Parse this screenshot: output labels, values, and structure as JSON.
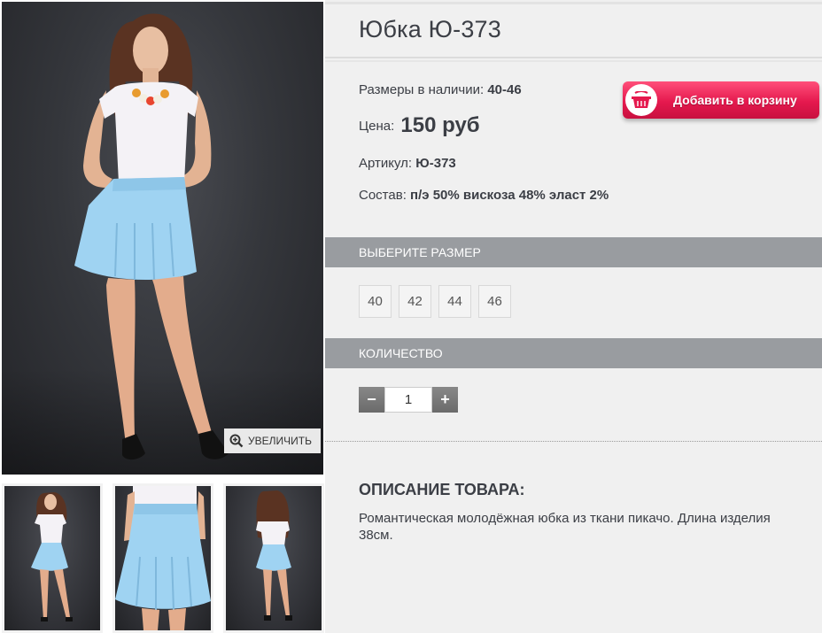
{
  "product": {
    "title": "Юбка Ю-373",
    "sizes_label": "Размеры в наличии:",
    "sizes_value": "40-46",
    "price_label": "Цена:",
    "price_value": "150 руб",
    "article_label": "Артикул:",
    "article_value": "Ю-373",
    "composition_label": "Состав:",
    "composition_value": "п/э 50% вискоза 48% эласт 2%"
  },
  "cart_button": {
    "label": "Добавить в корзину",
    "icon": "basket-icon",
    "color": "#e5194e"
  },
  "gallery": {
    "zoom_label": "УВЕЛИЧИТЬ",
    "zoom_icon": "zoom-in-icon",
    "skirt_color": "#9fd3f2",
    "thumbnails": [
      "front",
      "closeup",
      "back"
    ]
  },
  "size_section": {
    "title": "ВЫБЕРИТЕ РАЗМЕР",
    "options": [
      "40",
      "42",
      "44",
      "46"
    ]
  },
  "qty_section": {
    "title": "КОЛИЧЕСТВО",
    "minus": "−",
    "plus": "+",
    "value": "1"
  },
  "description": {
    "title": "ОПИСАНИЕ ТОВАРА:",
    "text": "Романтическая молодёжная юбка из ткани пикачо. Длина изделия 38см."
  }
}
